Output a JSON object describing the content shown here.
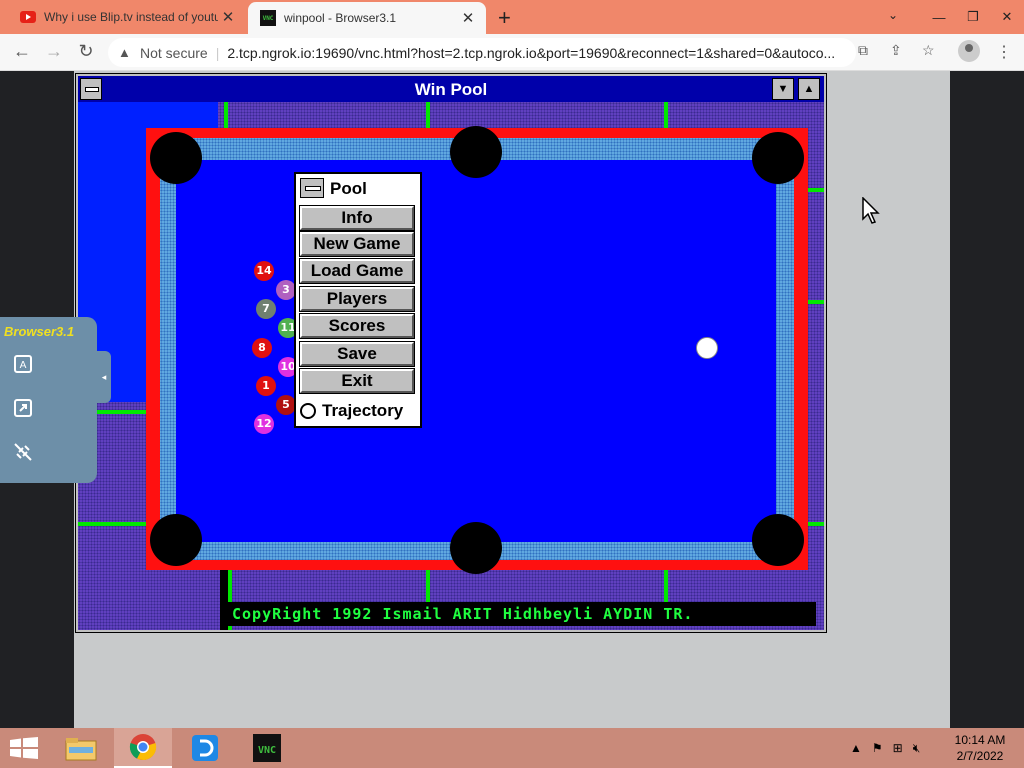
{
  "browser": {
    "tabs": [
      {
        "title": "Why i use Blip.tv instead of youtu",
        "favicon": "youtube-icon",
        "active": false
      },
      {
        "title": "winpool - Browser3.1",
        "favicon": "vnc-icon",
        "active": true
      }
    ],
    "security_label": "Not secure",
    "url": "2.tcp.ngrok.io:19690/vnc.html?host=2.tcp.ngrok.io&port=19690&reconnect=1&shared=0&autoco..."
  },
  "app": {
    "window_title": "Win Pool",
    "menu": {
      "title": "Pool",
      "buttons": [
        "Info",
        "New Game",
        "Load Game",
        "Players",
        "Scores",
        "Save",
        "Exit"
      ],
      "option_label": "Trajectory"
    },
    "copyright": "CopyRight 1992 Ismail ARIT Hidhbeyli AYDIN TR.",
    "balls": [
      {
        "num": "14",
        "color": "#e01010"
      },
      {
        "num": "3",
        "color": "#b060c0"
      },
      {
        "num": "7",
        "color": "#708070"
      },
      {
        "num": "11",
        "color": "#50b050"
      },
      {
        "num": "8",
        "color": "#e01010"
      },
      {
        "num": "10",
        "color": "#e030e0"
      },
      {
        "num": "1",
        "color": "#e01010"
      },
      {
        "num": "5",
        "color": "#b01010"
      },
      {
        "num": "12",
        "color": "#e030e0"
      }
    ]
  },
  "side_panel": {
    "brand": "Browser3.1"
  },
  "taskbar": {
    "time": "10:14 AM",
    "date": "2/7/2022"
  }
}
